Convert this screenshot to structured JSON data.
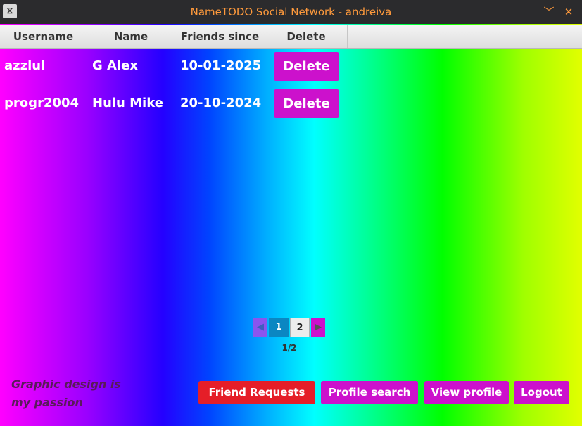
{
  "window": {
    "title": "NameTODO Social Network - andreiva",
    "app_icon": "app-logo-icon",
    "minimize_icon": "chevron-down-icon",
    "close_icon": "close-icon",
    "minimize_glyph": "﹀",
    "close_glyph": "✕",
    "app_glyph": "⧖"
  },
  "table": {
    "columns": [
      "Username",
      "Name",
      "Friends since",
      "Delete"
    ],
    "rows": [
      {
        "username": "azzlul",
        "name": "G Alex",
        "friends_since": "10-01-2025",
        "action": "Delete"
      },
      {
        "username": "progr2004",
        "name": "Hulu Mike",
        "friends_since": "20-10-2024",
        "action": "Delete"
      }
    ]
  },
  "pagination": {
    "prev_glyph": "◀",
    "next_glyph": "▶",
    "pages": [
      "1",
      "2"
    ],
    "current_page": 1,
    "indicator": "1/2"
  },
  "tagline": "Graphic design is my passion",
  "buttons": {
    "friend_requests": "Friend Requests",
    "profile_search": "Profile search",
    "view_profile": "View profile",
    "logout": "Logout"
  },
  "colors": {
    "title_text": "#ff9a3c",
    "delete_button": "#cc11cc",
    "friend_requests_button": "#e51e28",
    "active_page": "#0b87c2"
  }
}
